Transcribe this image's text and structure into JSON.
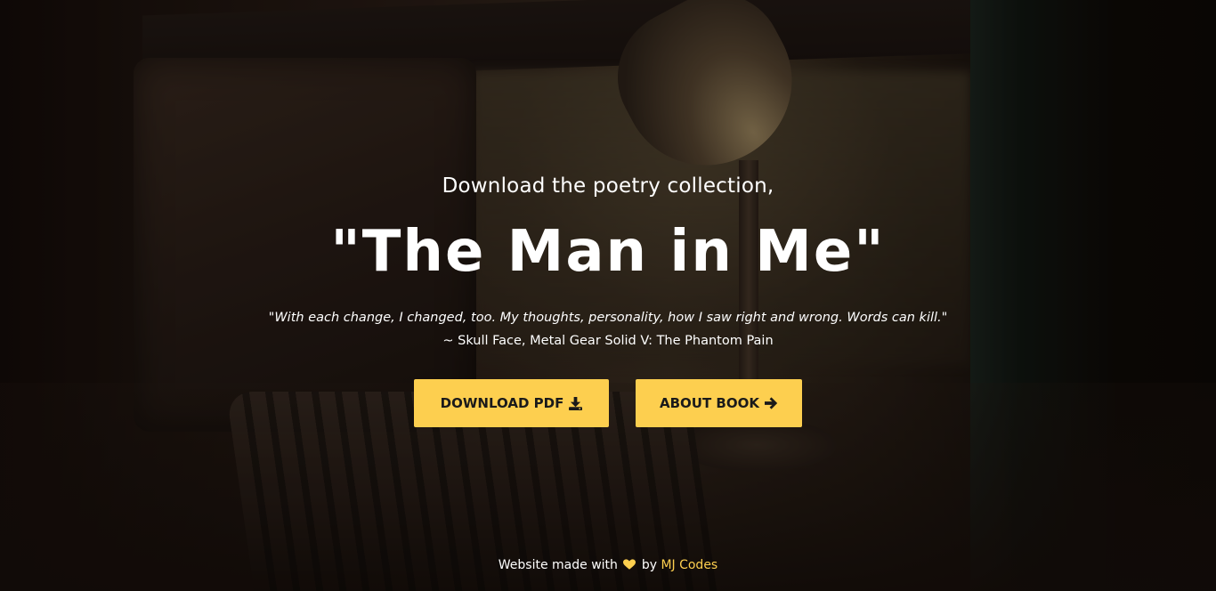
{
  "hero": {
    "subtitle": "Download the poetry collection,",
    "title": "\"The Man in Me\"",
    "quote": "\"With each change, I changed, too. My thoughts, personality, how I saw right and wrong. Words can kill.\"",
    "quote_author": "~ Skull Face, Metal Gear Solid V: The Phantom Pain"
  },
  "buttons": {
    "download_label": "DOWNLOAD PDF",
    "download_icon": "download-icon",
    "about_label": "ABOUT BOOK",
    "about_icon": "arrow-right-icon"
  },
  "footer": {
    "prefix": "Website made with",
    "heart_icon": "heart-icon",
    "by_text": "by",
    "author_link": "MJ Codes"
  },
  "colors": {
    "accent": "#fdcf4f",
    "text": "#ffffff",
    "button_text": "#1a1a1a"
  }
}
